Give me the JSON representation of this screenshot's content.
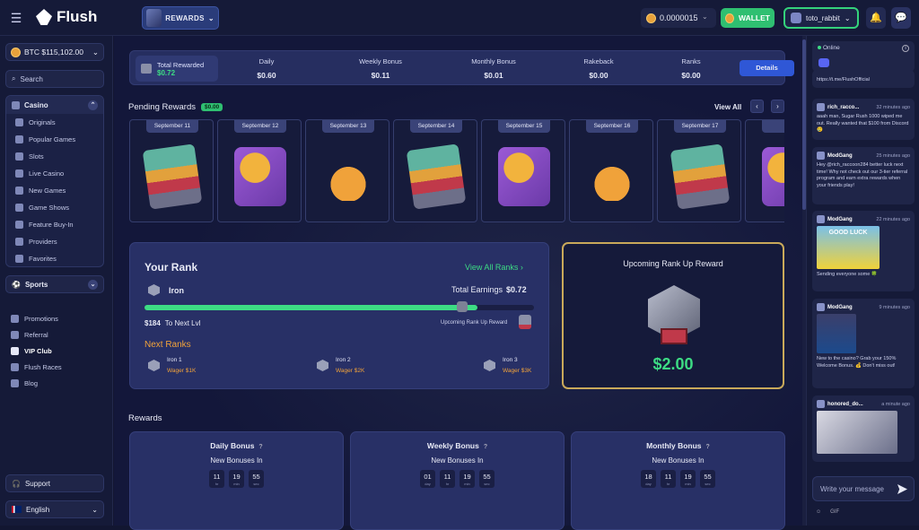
{
  "header": {
    "brand": "Flush",
    "rewards_label": "REWARDS",
    "balance": "0.0000015",
    "wallet_label": "WALLET",
    "username": "toto_rabbit"
  },
  "sidebar": {
    "btc_balance": "BTC $115,102.00",
    "search_label": "Search",
    "casino_label": "Casino",
    "casino_items": [
      "Originals",
      "Popular Games",
      "Slots",
      "Live Casino",
      "New Games",
      "Game Shows",
      "Feature Buy-In",
      "Providers",
      "Favorites"
    ],
    "sports_label": "Sports",
    "links": [
      "Promotions",
      "Referral",
      "VIP Club",
      "Flush Races",
      "Blog"
    ],
    "support_label": "Support",
    "language": "English"
  },
  "summary": {
    "total_label": "Total Rewarded",
    "total_value": "$0.72",
    "columns": [
      {
        "label": "Daily",
        "value": "$0.60"
      },
      {
        "label": "Weekly Bonus",
        "value": "$0.11"
      },
      {
        "label": "Monthly Bonus",
        "value": "$0.01"
      },
      {
        "label": "Rakeback",
        "value": "$0.00"
      },
      {
        "label": "Ranks",
        "value": "$0.00"
      }
    ],
    "details_label": "Details"
  },
  "pending": {
    "title": "Pending Rewards",
    "badge": "$0.00",
    "view_all": "View All",
    "cards": [
      {
        "date": "September 11",
        "art": "chest"
      },
      {
        "date": "September 12",
        "art": "purple"
      },
      {
        "date": "September 13",
        "art": "bag"
      },
      {
        "date": "September 14",
        "art": "chest"
      },
      {
        "date": "September 15",
        "art": "purple"
      },
      {
        "date": "September 16",
        "art": "bag"
      },
      {
        "date": "September 17",
        "art": "chest"
      },
      {
        "date": "Se",
        "art": "purple"
      }
    ]
  },
  "rank": {
    "title": "Your Rank",
    "view_all": "View All Ranks ›",
    "current": "Iron",
    "earnings_label": "Total Earnings",
    "earnings_value": "$0.72",
    "progress_fraction": 0.855,
    "to_next": "$184",
    "to_next_label": "To Next Lvl",
    "upcoming_label": "Upcoming Rank Up Reward",
    "next_title": "Next Ranks",
    "next": [
      {
        "name": "Iron 1",
        "wager": "Wager $1K"
      },
      {
        "name": "Iron 2",
        "wager": "Wager $2K"
      },
      {
        "name": "Iron 3",
        "wager": "Wager $3K"
      }
    ]
  },
  "upcoming": {
    "title": "Upcoming Rank Up Reward",
    "value": "$2.00"
  },
  "rewards": {
    "title": "Rewards",
    "cards": [
      {
        "title": "Daily Bonus",
        "sub": "New Bonuses In",
        "timer": [
          {
            "v": "11",
            "u": "hr"
          },
          {
            "v": "19",
            "u": "min"
          },
          {
            "v": "55",
            "u": "sec"
          }
        ]
      },
      {
        "title": "Weekly Bonus",
        "sub": "New Bonuses In",
        "timer": [
          {
            "v": "01",
            "u": "day"
          },
          {
            "v": "11",
            "u": "hr"
          },
          {
            "v": "19",
            "u": "min"
          },
          {
            "v": "55",
            "u": "sec"
          }
        ]
      },
      {
        "title": "Monthly Bonus",
        "sub": "New Bonuses In",
        "timer": [
          {
            "v": "18",
            "u": "day"
          },
          {
            "v": "11",
            "u": "hr"
          },
          {
            "v": "19",
            "u": "min"
          },
          {
            "v": "55",
            "u": "sec"
          }
        ]
      }
    ]
  },
  "chat": {
    "online_label": "Online",
    "messages": [
      {
        "name": "",
        "time": "",
        "text": "https://t.me/FlushOfficial"
      },
      {
        "name": "rich_racco...",
        "time": "32 minutes ago",
        "text": "aaah man, Sugar Rush 1000 wiped me out. Really wanted that $100 from Discord 😢"
      },
      {
        "name": "ModGang",
        "time": "25 minutes ago",
        "text": "Hey @rich_raccoon284 better luck next time! Why not check out our 3-tier referral program and earn extra rewards when your friends play!"
      },
      {
        "name": "ModGang",
        "time": "22 minutes ago",
        "text": "Sending everyone some 🍀",
        "gif": "GOOD LUCK"
      },
      {
        "name": "ModGang",
        "time": "9 minutes ago",
        "text": "New to the casino? Grab your 150% Welcome Bonus. 💰 Don't miss out!"
      },
      {
        "name": "honored_do...",
        "time": "a minute ago",
        "text": ""
      }
    ],
    "input_placeholder": "Write your message",
    "footer": [
      "☺",
      "GIF"
    ]
  },
  "colors": {
    "accent_green": "#3ddc84",
    "gold": "#f2a33a",
    "primary_blue": "#2f57d6",
    "background": "#121631"
  }
}
